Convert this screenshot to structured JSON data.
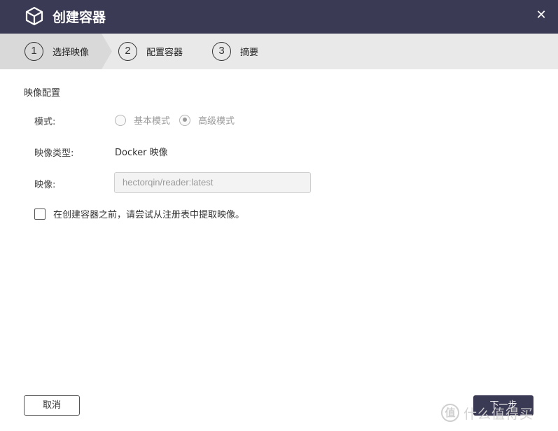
{
  "dialog": {
    "title": "创建容器",
    "title_icon": "cube-icon",
    "close_glyph": "✕"
  },
  "steps": [
    {
      "number": "1",
      "label": "选择映像",
      "active": true
    },
    {
      "number": "2",
      "label": "配置容器",
      "active": false
    },
    {
      "number": "3",
      "label": "摘要",
      "active": false
    }
  ],
  "form": {
    "section_title": "映像配置",
    "mode_label": "模式:",
    "mode_options": [
      {
        "label": "基本模式",
        "checked": false
      },
      {
        "label": "高级模式",
        "checked": true
      }
    ],
    "image_type_label": "映像类型:",
    "image_type_value": "Docker 映像",
    "image_label": "映像:",
    "image_value": "hectorqin/reader:latest",
    "pull_checkbox_label": "在创建容器之前，请尝试从注册表中提取映像。",
    "pull_checked": false
  },
  "footer": {
    "cancel_label": "取消",
    "next_label": "下一步"
  },
  "watermark": {
    "logo_glyph": "值",
    "text": "什么值得买"
  },
  "colors": {
    "titlebar": "#3b3a54",
    "stepbar": "#e9e9e9",
    "primary_button": "#3b3a54"
  }
}
